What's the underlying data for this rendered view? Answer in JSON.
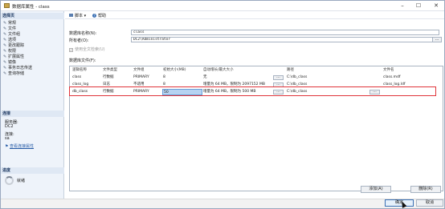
{
  "window": {
    "title": "数据库属性 - class"
  },
  "left": {
    "select_page_title": "选择页",
    "pages": [
      "常规",
      "文件",
      "文件组",
      "选项",
      "更改跟踪",
      "权限",
      "扩展属性",
      "镜像",
      "事务日志传送",
      "查询存储"
    ],
    "connection_title": "连接",
    "server_label": "服务器:",
    "server_value": "DC2",
    "connection_label": "连接:",
    "connection_value": "sa",
    "view_connection_link": "查看连接属性",
    "progress_title": "进度",
    "progress_status": "就绪"
  },
  "toolbar": {
    "script_label": "脚本",
    "help_label": "帮助"
  },
  "form": {
    "db_name_label": "数据库名称(N):",
    "db_name_value": "class",
    "owner_label": "所有者(O):",
    "owner_value": "DC2\\Administrator",
    "owner_browse": "...",
    "fulltext_label": "使用全文检索(U)",
    "files_label": "数据库文件(F):"
  },
  "grid": {
    "headers": [
      "逻辑名称",
      "文件类型",
      "文件组",
      "初始大小(MB)",
      "自动增长/最大大小",
      "路径",
      "文件名"
    ],
    "rows": [
      {
        "name": "class",
        "type": "行数据",
        "group": "PRIMARY",
        "size": "8",
        "growth": "无",
        "path": "C:\\db_class",
        "file": "class.mdf"
      },
      {
        "name": "class_log",
        "type": "日志",
        "group": "不适用",
        "size": "8",
        "growth": "增量为 64 MB，限制为 2097152 MB",
        "path": "C:\\db_class",
        "file": "class_log.ldf"
      },
      {
        "name": "db_class",
        "type": "行数据",
        "group": "PRIMARY",
        "size": "50",
        "growth": "增量为 64 MB，限制为 500 MB",
        "path": "C:\\db_class",
        "file": ""
      }
    ]
  },
  "buttons": {
    "add": "添加(A)",
    "remove": "删除(R)",
    "ok": "确定",
    "cancel": "取消"
  },
  "colors": {
    "highlight_box": "#e0353b",
    "selected_cell": "#b6d3f2",
    "accent": "#3a6fb4"
  }
}
